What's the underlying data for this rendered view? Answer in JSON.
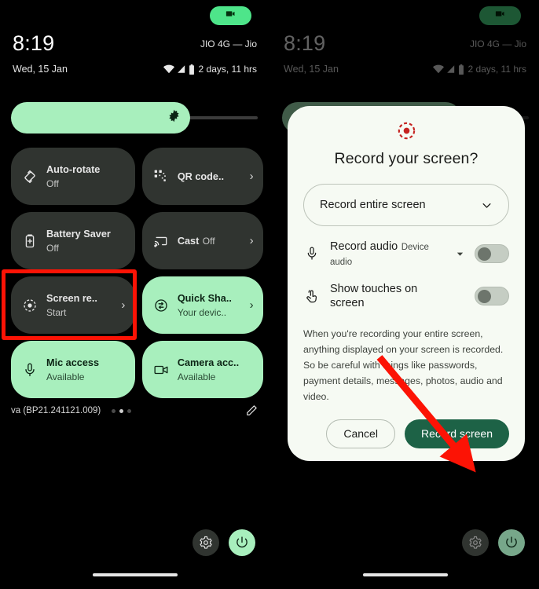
{
  "statusbar": {
    "clock": "8:19",
    "carrier": "JIO 4G — Jio",
    "date": "Wed, 15 Jan",
    "battery_text": "2 days, 11 hrs",
    "camera_pill_icon": "camcorder-icon",
    "wifi_icon": "wifi-icon",
    "signal_icon": "cellular-signal-icon",
    "battery_icon": "battery-icon"
  },
  "brightness": {
    "icon": "brightness-icon",
    "level_percent": 72
  },
  "tiles": [
    {
      "title": "Auto-rotate",
      "subtitle": "Off",
      "icon": "auto-rotate-icon",
      "active": false,
      "chevron": false
    },
    {
      "title": "QR code..",
      "subtitle": "",
      "icon": "qr-code-icon",
      "active": false,
      "chevron": true
    },
    {
      "title": "Battery Saver",
      "subtitle": "Off",
      "icon": "battery-saver-icon",
      "active": false,
      "chevron": false
    },
    {
      "title": "Cast",
      "subtitle": "Off",
      "icon": "cast-icon",
      "active": false,
      "chevron": true
    },
    {
      "title": "Screen re..",
      "subtitle": "Start",
      "icon": "screen-record-icon",
      "active": false,
      "chevron": true
    },
    {
      "title": "Quick Sha..",
      "subtitle": "Your devic..",
      "icon": "quick-share-icon",
      "active": true,
      "chevron": true
    },
    {
      "title": "Mic access",
      "subtitle": "Available",
      "icon": "microphone-icon",
      "active": true,
      "chevron": false
    },
    {
      "title": "Camera acc..",
      "subtitle": "Available",
      "icon": "camcorder-icon",
      "active": true,
      "chevron": false
    }
  ],
  "footer": {
    "build": "va (BP21.241121.009)",
    "page_dots": 3,
    "active_dot": 1,
    "edit_icon": "pencil-icon"
  },
  "bottombar": {
    "settings_icon": "gear-icon",
    "power_icon": "power-icon",
    "nav_handle": "home-handle"
  },
  "dialog": {
    "header_icon": "screen-record-icon",
    "title": "Record your screen?",
    "dropdown": {
      "value": "Record entire screen",
      "chevron_icon": "chevron-down-icon"
    },
    "options": [
      {
        "title": "Record audio",
        "subtitle": "Device audio",
        "icon": "microphone-icon",
        "caret": true,
        "toggle_on": false
      },
      {
        "title": "Show touches on screen",
        "subtitle": "",
        "icon": "touch-icon",
        "caret": false,
        "toggle_on": false
      }
    ],
    "body": "When you're recording your entire screen, anything displayed on your screen is recorded. So be careful with things like passwords, payment details, messages, photos, audio and video.",
    "cancel_label": "Cancel",
    "record_label": "Record screen"
  },
  "annotations": {
    "highlight_color": "#fc1305",
    "box_target": "screen-record-tile",
    "arrow_target": "record-screen-button"
  }
}
